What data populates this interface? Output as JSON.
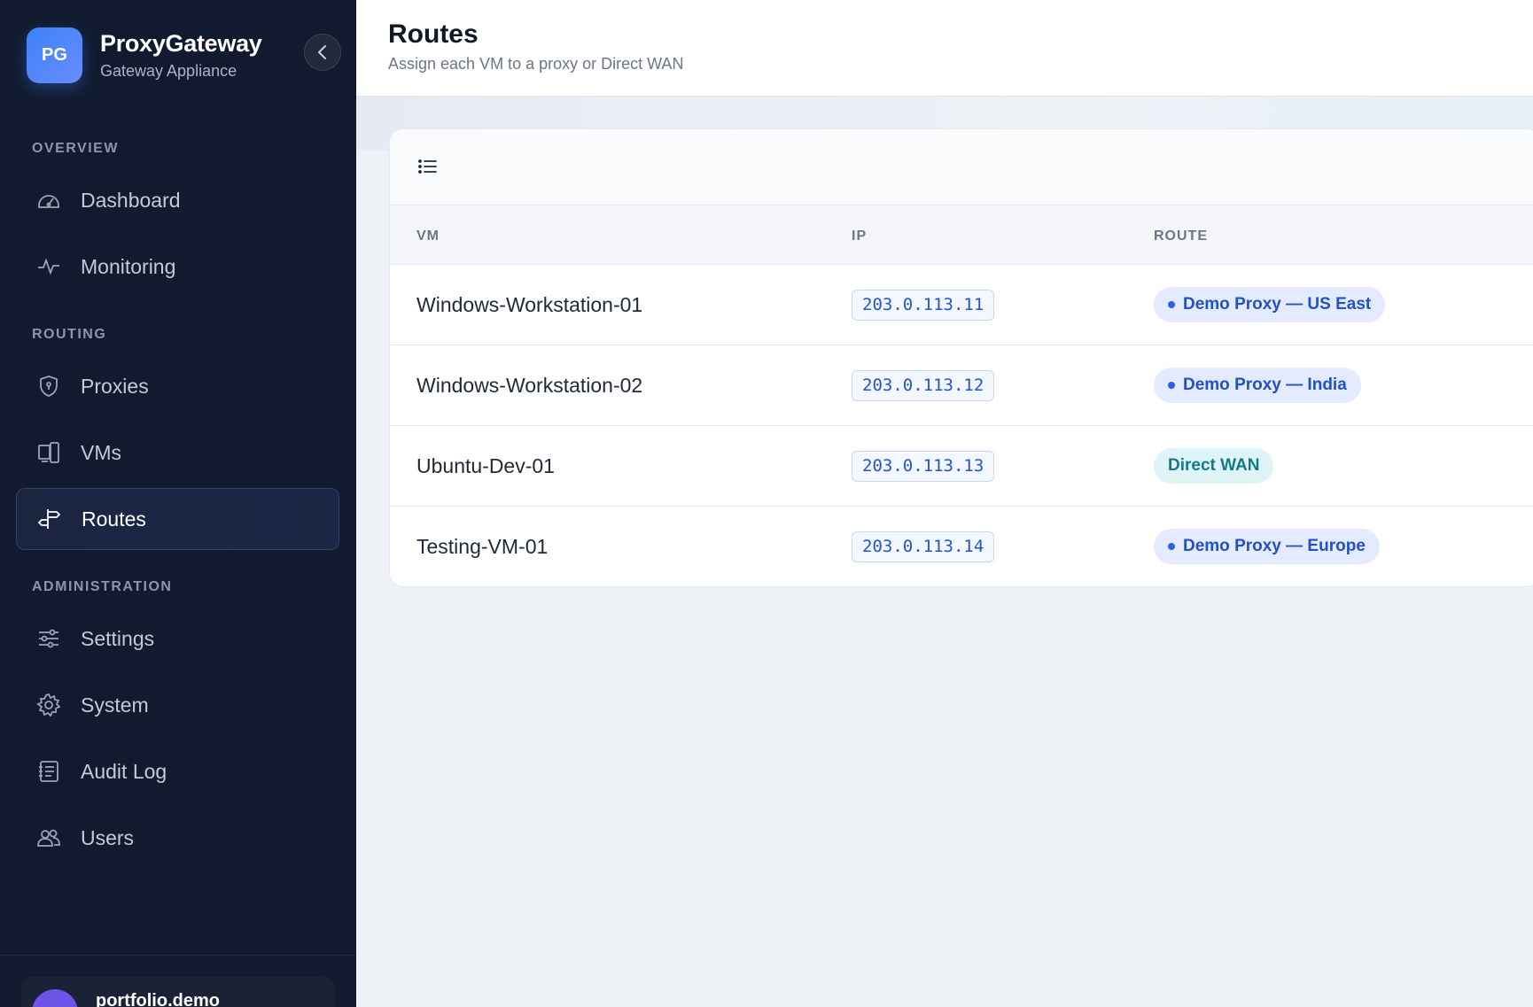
{
  "brand": {
    "logo_text": "PG",
    "name": "ProxyGateway",
    "subtitle": "Gateway Appliance"
  },
  "nav": {
    "sections": [
      {
        "label": "OVERVIEW"
      },
      {
        "label": "ROUTING"
      },
      {
        "label": "ADMINISTRATION"
      }
    ],
    "items": [
      {
        "label": "Dashboard",
        "icon": "gauge-icon"
      },
      {
        "label": "Monitoring",
        "icon": "activity-icon"
      },
      {
        "label": "Proxies",
        "icon": "shield-icon"
      },
      {
        "label": "VMs",
        "icon": "devices-icon"
      },
      {
        "label": "Routes",
        "icon": "signpost-icon",
        "active": true
      },
      {
        "label": "Settings",
        "icon": "sliders-icon"
      },
      {
        "label": "System",
        "icon": "gear-icon"
      },
      {
        "label": "Audit Log",
        "icon": "log-icon"
      },
      {
        "label": "Users",
        "icon": "users-icon"
      }
    ]
  },
  "user": {
    "name": "portfolio.demo"
  },
  "header": {
    "title": "Routes",
    "subtitle": "Assign each VM to a proxy or Direct WAN"
  },
  "table": {
    "columns": [
      "VM",
      "IP",
      "ROUTE"
    ],
    "rows": [
      {
        "vm": "Windows-Workstation-01",
        "ip": "203.0.113.11",
        "route": "Demo Proxy — US East",
        "route_type": "proxy"
      },
      {
        "vm": "Windows-Workstation-02",
        "ip": "203.0.113.12",
        "route": "Demo Proxy — India",
        "route_type": "proxy"
      },
      {
        "vm": "Ubuntu-Dev-01",
        "ip": "203.0.113.13",
        "route": "Direct WAN",
        "route_type": "wan"
      },
      {
        "vm": "Testing-VM-01",
        "ip": "203.0.113.14",
        "route": "Demo Proxy — Europe",
        "route_type": "proxy"
      }
    ]
  },
  "colors": {
    "sidebar_bg": "#111a2e",
    "accent": "#3b82f6",
    "proxy_badge": "#e4ebff",
    "wan_badge": "#dff4f7"
  }
}
